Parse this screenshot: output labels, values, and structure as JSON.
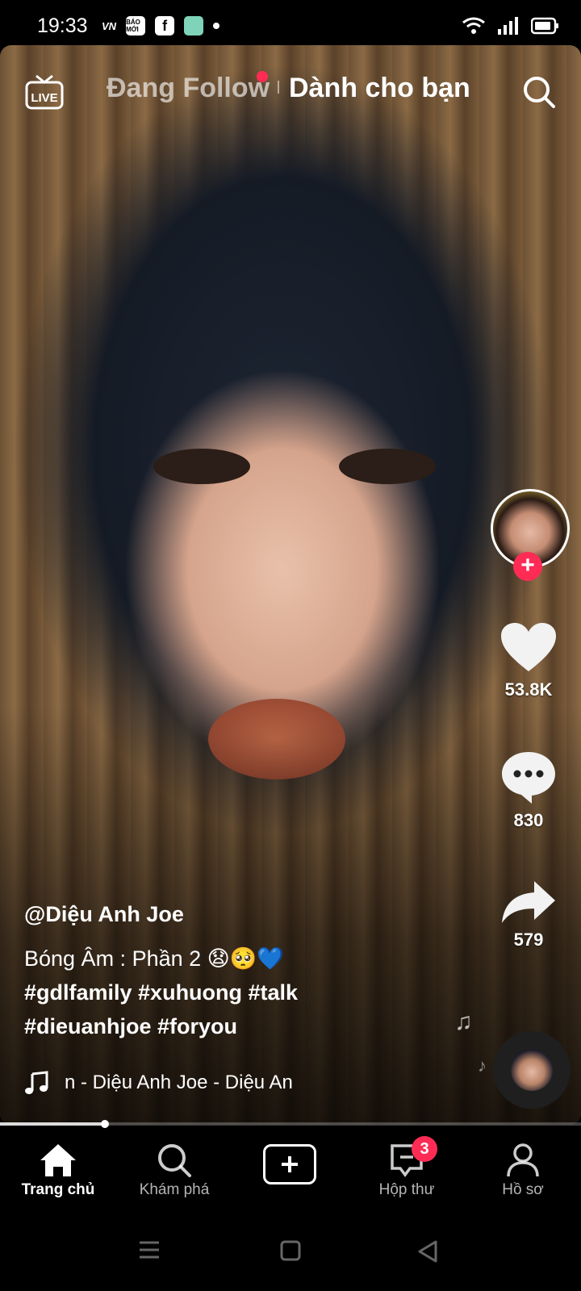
{
  "status_bar": {
    "time": "19:33",
    "app_icons": [
      "vtv-icon",
      "bao-moi-icon",
      "facebook-icon",
      "app-icon",
      "dot-icon"
    ],
    "badge_bao_moi": "BÁO MỚI"
  },
  "top_bar": {
    "live_label": "LIVE",
    "tab_following": "Đang Follow",
    "tab_for_you": "Dành cho bạn"
  },
  "actions": {
    "likes": "53.8K",
    "comments": "830",
    "shares": "579"
  },
  "post": {
    "author": "@Diệu Anh Joe",
    "caption_text": "Bóng Âm : Phần 2 😧🥺💙",
    "hashtags_line1": "#gdlfamily #xuhuong #talk",
    "hashtags_line2": "#dieuanhjoe #foryou",
    "music": "n - Diệu Anh Joe - Diệu An"
  },
  "progress": 0.18,
  "nav": {
    "home": "Trang chủ",
    "discover": "Khám phá",
    "inbox": "Hộp thư",
    "inbox_badge": "3",
    "profile": "Hồ sơ"
  },
  "colors": {
    "accent": "#fe2c55",
    "background": "#000000"
  }
}
